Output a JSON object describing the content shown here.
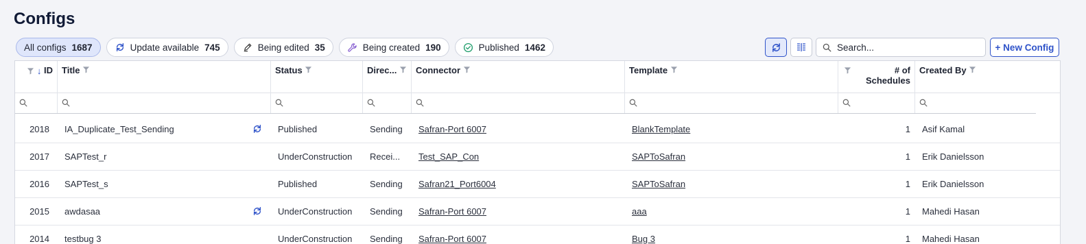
{
  "page": {
    "title": "Configs"
  },
  "chips": [
    {
      "label": "All configs",
      "count": "1687",
      "icon": "none"
    },
    {
      "label": "Update available",
      "count": "745",
      "icon": "sync-icon"
    },
    {
      "label": "Being edited",
      "count": "35",
      "icon": "pencil-icon"
    },
    {
      "label": "Being created",
      "count": "190",
      "icon": "wrench-icon"
    },
    {
      "label": "Published",
      "count": "1462",
      "icon": "check-circle-icon"
    }
  ],
  "toolbar": {
    "search_placeholder": "Search...",
    "new_config_label": "+ New Config"
  },
  "columns": {
    "id": "ID",
    "title": "Title",
    "status": "Status",
    "direction": "Direc...",
    "connector": "Connector",
    "template": "Template",
    "schedules_line1": "# of",
    "schedules_line2": "Schedules",
    "created_by": "Created By"
  },
  "rows": [
    {
      "id": "2018",
      "title": "IA_Duplicate_Test_Sending",
      "update": true,
      "status": "Published",
      "direction": "Sending",
      "connector": "Safran-Port 6007",
      "template": "BlankTemplate",
      "schedules": "1",
      "created_by": "Asif Kamal"
    },
    {
      "id": "2017",
      "title": "SAPTest_r",
      "update": false,
      "status": "UnderConstruction",
      "direction": "Recei...",
      "connector": "Test_SAP_Con",
      "template": "SAPToSafran",
      "schedules": "1",
      "created_by": "Erik Danielsson"
    },
    {
      "id": "2016",
      "title": "SAPTest_s",
      "update": false,
      "status": "Published",
      "direction": "Sending",
      "connector": "Safran21_Port6004",
      "template": "SAPToSafran",
      "schedules": "1",
      "created_by": "Erik Danielsson"
    },
    {
      "id": "2015",
      "title": "awdasaa",
      "update": true,
      "status": "UnderConstruction",
      "direction": "Sending",
      "connector": "Safran-Port 6007",
      "template": "aaa",
      "schedules": "1",
      "created_by": "Mahedi Hasan"
    },
    {
      "id": "2014",
      "title": "testbug 3",
      "update": false,
      "status": "UnderConstruction",
      "direction": "Sending",
      "connector": "Safran-Port 6007",
      "template": "Bug 3",
      "schedules": "1",
      "created_by": "Mahedi Hasan"
    }
  ],
  "colors": {
    "accent": "#2f53c9",
    "chip_active_bg": "#dfe6fb",
    "page_bg": "#f3f4f8"
  }
}
